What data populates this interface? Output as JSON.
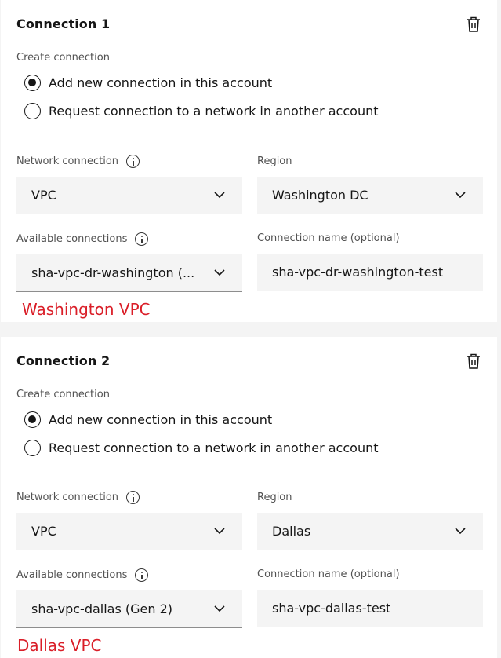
{
  "connections": [
    {
      "title": "Connection 1",
      "create_label": "Create connection",
      "options": [
        {
          "label": "Add new connection in this account",
          "checked": true
        },
        {
          "label": "Request connection to a network in another account",
          "checked": false
        }
      ],
      "network_label": "Network connection",
      "network_value": "VPC",
      "region_label": "Region",
      "region_value": "Washington DC",
      "available_label": "Available connections",
      "available_value": "sha-vpc-dr-washington (...",
      "name_label": "Connection name (optional)",
      "name_value": "sha-vpc-dr-washington-test",
      "annotation": "Washington VPC"
    },
    {
      "title": "Connection 2",
      "create_label": "Create connection",
      "options": [
        {
          "label": "Add new connection in this account",
          "checked": true
        },
        {
          "label": "Request connection to a network in another account",
          "checked": false
        }
      ],
      "network_label": "Network connection",
      "network_value": "VPC",
      "region_label": "Region",
      "region_value": "Dallas",
      "available_label": "Available connections",
      "available_value": "sha-vpc-dallas (Gen 2)",
      "name_label": "Connection name (optional)",
      "name_value": "sha-vpc-dallas-test",
      "annotation": "Dallas VPC"
    }
  ],
  "icons": {
    "delete": "trash-can-icon",
    "info": "information-icon",
    "dropdown": "chevron-down-icon"
  },
  "colors": {
    "annotation": "#da1e28",
    "field_bg": "#f4f4f4"
  }
}
